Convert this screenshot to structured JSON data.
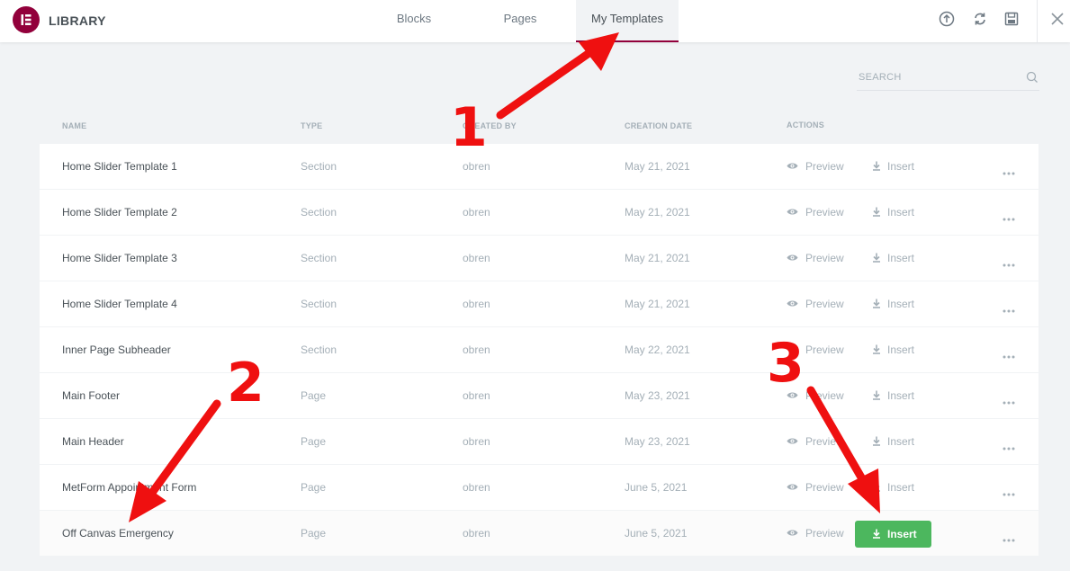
{
  "header": {
    "title": "LIBRARY",
    "tabs": [
      {
        "label": "Blocks"
      },
      {
        "label": "Pages"
      },
      {
        "label": "My Templates"
      }
    ]
  },
  "search": {
    "placeholder": "SEARCH",
    "value": ""
  },
  "columns": {
    "name": "NAME",
    "type": "TYPE",
    "author": "CREATED BY",
    "date": "CREATION DATE",
    "actions": "ACTIONS"
  },
  "rows": [
    {
      "name": "Home Slider Template 1",
      "type": "Section",
      "author": "obren",
      "date": "May 21, 2021",
      "preview": "Preview",
      "insert": "Insert"
    },
    {
      "name": "Home Slider Template 2",
      "type": "Section",
      "author": "obren",
      "date": "May 21, 2021",
      "preview": "Preview",
      "insert": "Insert"
    },
    {
      "name": "Home Slider Template 3",
      "type": "Section",
      "author": "obren",
      "date": "May 21, 2021",
      "preview": "Preview",
      "insert": "Insert"
    },
    {
      "name": "Home Slider Template 4",
      "type": "Section",
      "author": "obren",
      "date": "May 21, 2021",
      "preview": "Preview",
      "insert": "Insert"
    },
    {
      "name": "Inner Page Subheader",
      "type": "Section",
      "author": "obren",
      "date": "May 22, 2021",
      "preview": "Preview",
      "insert": "Insert"
    },
    {
      "name": "Main Footer",
      "type": "Page",
      "author": "obren",
      "date": "May 23, 2021",
      "preview": "Preview",
      "insert": "Insert"
    },
    {
      "name": "Main Header",
      "type": "Page",
      "author": "obren",
      "date": "May 23, 2021",
      "preview": "Preview",
      "insert": "Insert"
    },
    {
      "name": "MetForm Appointment Form",
      "type": "Page",
      "author": "obren",
      "date": "June 5, 2021",
      "preview": "Preview",
      "insert": "Insert"
    },
    {
      "name": "Off Canvas Emergency",
      "type": "Page",
      "author": "obren",
      "date": "June 5, 2021",
      "preview": "Preview",
      "insert": "Insert"
    }
  ],
  "annotations": {
    "step1": "1",
    "step2": "2",
    "step3": "3",
    "color": "#ef1010"
  },
  "colors": {
    "brand": "#92003b",
    "insert_active": "#4cb75e"
  }
}
